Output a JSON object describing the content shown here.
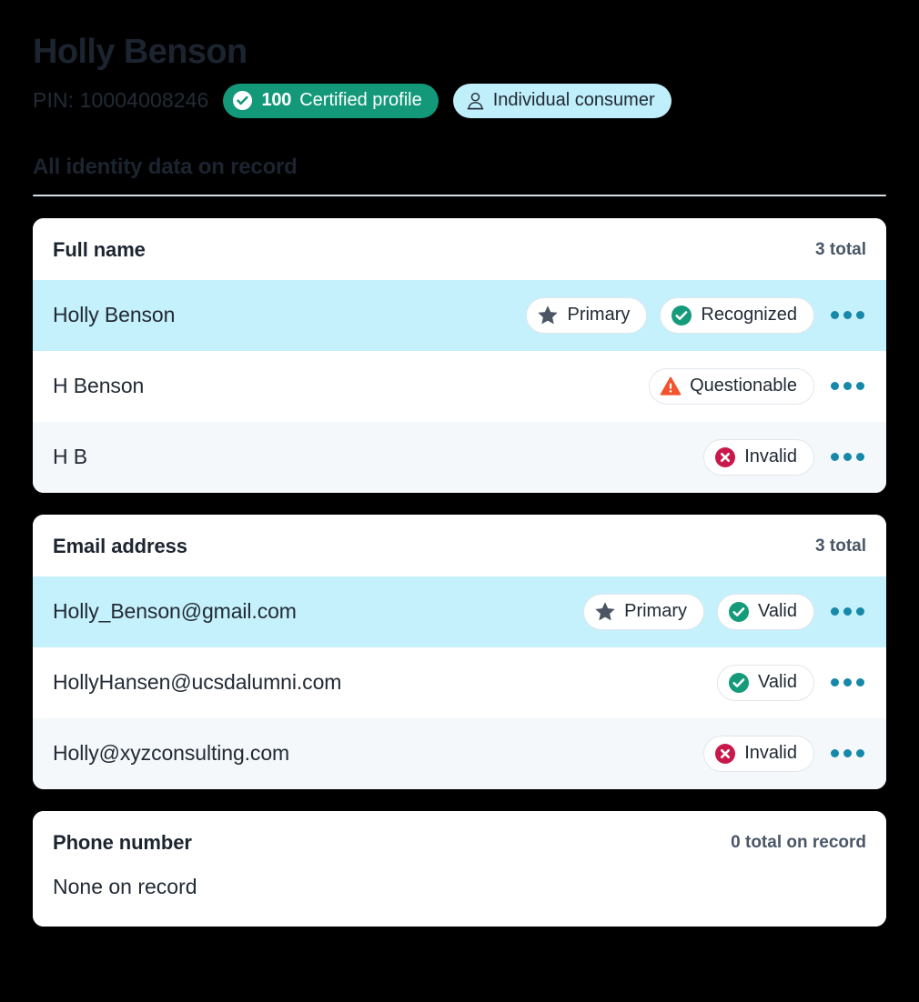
{
  "header": {
    "name": "Holly Benson",
    "pin_label": "PIN: 10004008246",
    "certified_badge": {
      "score": "100",
      "label": "Certified profile",
      "icon": "check-circle-icon",
      "color": "#13997A"
    },
    "consumer_badge": {
      "label": "Individual consumer",
      "icon": "person-icon",
      "color": "#BFEFFB"
    }
  },
  "section": {
    "title": "All identity data on record"
  },
  "cards": [
    {
      "title": "Full name",
      "count": "3 total",
      "rows": [
        {
          "value": "Holly Benson",
          "highlighted": true,
          "tags": [
            {
              "label": "Primary",
              "icon": "star-icon"
            },
            {
              "label": "Recognized",
              "icon": "check-circle-icon"
            }
          ],
          "menu": "more-options"
        },
        {
          "value": "H Benson",
          "highlighted": false,
          "tags": [
            {
              "label": "Questionable",
              "icon": "warning-triangle-icon"
            }
          ],
          "menu": "more-options"
        },
        {
          "value": "H B",
          "highlighted": false,
          "tags": [
            {
              "label": "Invalid",
              "icon": "x-circle-icon"
            }
          ],
          "menu": "more-options"
        }
      ]
    },
    {
      "title": "Email address",
      "count": "3 total",
      "rows": [
        {
          "value": "Holly_Benson@gmail.com",
          "highlighted": true,
          "tags": [
            {
              "label": "Primary",
              "icon": "star-icon"
            },
            {
              "label": "Valid",
              "icon": "check-circle-icon"
            }
          ],
          "menu": "more-options"
        },
        {
          "value": "HollyHansen@ucsdalumni.com",
          "highlighted": false,
          "tags": [
            {
              "label": "Valid",
              "icon": "check-circle-icon"
            }
          ],
          "menu": "more-options"
        },
        {
          "value": "Holly@xyzconsulting.com",
          "highlighted": false,
          "tags": [
            {
              "label": "Invalid",
              "icon": "x-circle-icon"
            }
          ],
          "menu": "more-options"
        }
      ]
    },
    {
      "title": "Phone number",
      "count": "0 total on record",
      "empty_text": "None on record",
      "rows": []
    }
  ],
  "colors": {
    "valid_green": "#159B79",
    "warning_orange": "#F2522E",
    "invalid_red": "#C9194A",
    "highlight_blue": "#C4F1FB",
    "kebab_teal": "#1688A9",
    "star_slate": "#4B5563"
  }
}
